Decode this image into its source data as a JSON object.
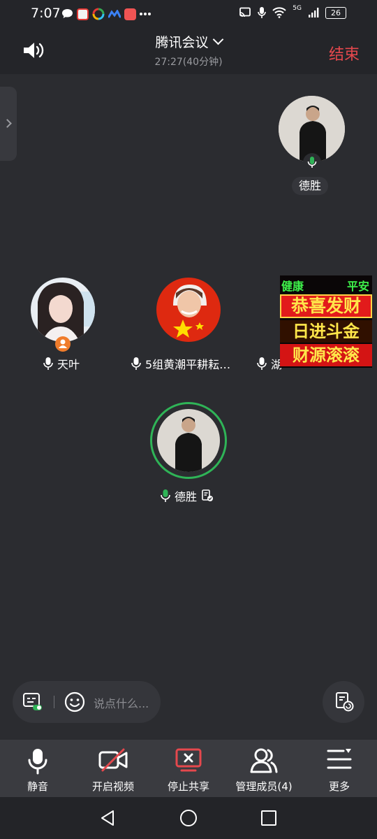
{
  "status": {
    "time": "7:07",
    "network": "5G",
    "battery": "26"
  },
  "header": {
    "title": "腾讯会议",
    "timer": "27:27(40分钟)",
    "end_label": "结束"
  },
  "participants": {
    "top_right_name": "德胜",
    "row": [
      {
        "name": "天叶"
      },
      {
        "name": "5组黄潮平耕耘…"
      },
      {
        "name": "湖"
      }
    ],
    "sticker": {
      "line1_left": "健康",
      "line1_right": "平安",
      "line2": "恭喜发财",
      "line3": "日进斗金",
      "line4": "财源滚滚"
    },
    "speaker_name": "德胜"
  },
  "chat": {
    "placeholder": "说点什么..."
  },
  "toolbar": {
    "mute": "静音",
    "video": "开启视频",
    "share": "停止共享",
    "members": "管理成员(4)",
    "more": "更多"
  },
  "colors": {
    "accent_red": "#e5484d",
    "accent_green": "#2fb457",
    "orange_badge": "#f07c2b",
    "background": "#2b2c30"
  }
}
